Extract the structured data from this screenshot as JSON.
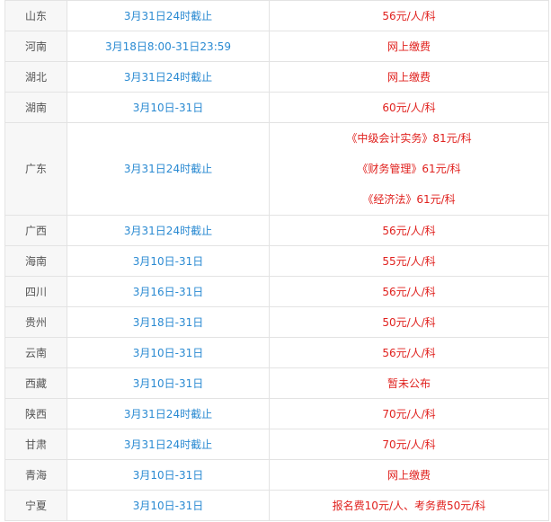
{
  "table": {
    "rows": [
      {
        "province": "山东",
        "date": "3月31日24时截止",
        "fee": "56元/人/科"
      },
      {
        "province": "河南",
        "date": "3月18日8:00-31日23:59",
        "fee": "网上缴费"
      },
      {
        "province": "湖北",
        "date": "3月31日24时截止",
        "fee": "网上缴费"
      },
      {
        "province": "湖南",
        "date": "3月10日-31日",
        "fee": "60元/人/科"
      },
      {
        "province": "广东",
        "date": "3月31日24时截止",
        "fee_lines": [
          "《中级会计实务》81元/科",
          "《财务管理》61元/科",
          "《经济法》61元/科"
        ]
      },
      {
        "province": "广西",
        "date": "3月31日24时截止",
        "fee": "56元/人/科"
      },
      {
        "province": "海南",
        "date": "3月10日-31日",
        "fee": "55元/人/科"
      },
      {
        "province": "四川",
        "date": "3月16日-31日",
        "fee": "56元/人/科"
      },
      {
        "province": "贵州",
        "date": "3月18日-31日",
        "fee": "50元/人/科"
      },
      {
        "province": "云南",
        "date": "3月10日-31日",
        "fee": "56元/人/科"
      },
      {
        "province": "西藏",
        "date": "3月10日-31日",
        "fee": "暂未公布"
      },
      {
        "province": "陕西",
        "date": "3月31日24时截止",
        "fee": "70元/人/科"
      },
      {
        "province": "甘肃",
        "date": "3月31日24时截止",
        "fee": "70元/人/科"
      },
      {
        "province": "青海",
        "date": "3月10日-31日",
        "fee": "网上缴费"
      },
      {
        "province": "宁夏",
        "date": "3月10日-31日",
        "fee": "报名费10元/人、考务费50元/科"
      }
    ]
  },
  "colors": {
    "province_text": "#555555",
    "date_text": "#2a8ad2",
    "fee_text": "#e0211e",
    "province_bg": "#f7f7f7",
    "border": "#e3e3e3"
  }
}
